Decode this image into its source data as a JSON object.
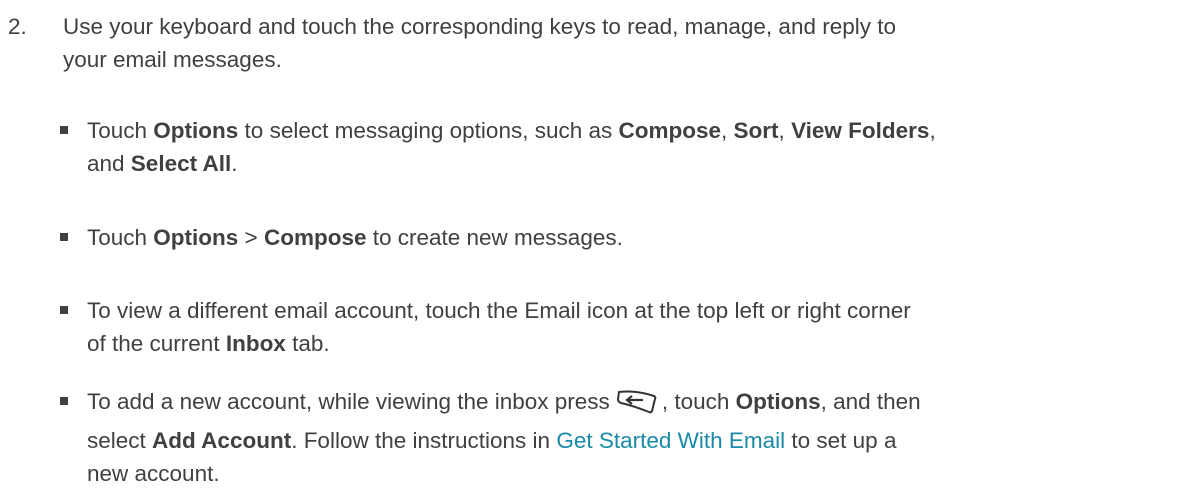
{
  "step": {
    "number": "2.",
    "line1": "Use your keyboard and touch the corresponding keys to read, manage, and reply to",
    "line2": "your email messages."
  },
  "bullets": [
    {
      "t1": "Touch ",
      "b1": "Options",
      "t2": " to select messaging options, such as ",
      "b2": "Compose",
      "t3": ", ",
      "b3": "Sort",
      "t4": ", ",
      "b4": "View Folders",
      "t5": ",",
      "t6": "and ",
      "b5": "Select All",
      "t7": "."
    },
    {
      "t1": "Touch ",
      "b1": "Options",
      "t2": " > ",
      "b2": "Compose",
      "t3": " to create new messages."
    },
    {
      "t1": "To view a different email account, touch the Email icon at the top left or right corner",
      "t2": "of the current ",
      "b1": "Inbox",
      "t3": " tab."
    },
    {
      "t1": "To add a new account, while viewing the inbox press",
      "t2": ", touch ",
      "b1": "Options",
      "t3": ", and then",
      "t4": "select ",
      "b2": "Add Account",
      "t5": ". Follow the instructions in ",
      "link": "Get Started With Email",
      "t6": " to set up a",
      "t7": "new account."
    }
  ],
  "icons": {
    "back_key": "back-key-icon"
  },
  "colors": {
    "text": "#404040",
    "link": "#1a8aa7"
  }
}
